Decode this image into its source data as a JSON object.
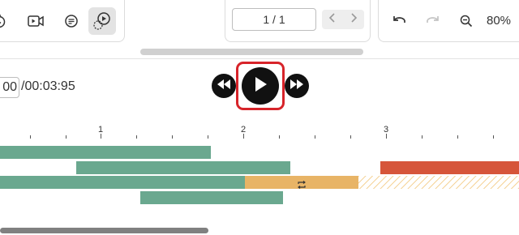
{
  "toolbar": {
    "left_tools": [
      {
        "icon": "timer-icon",
        "active": false
      },
      {
        "icon": "video-icon",
        "active": false
      },
      {
        "icon": "caption-icon",
        "active": false
      },
      {
        "icon": "play-mode-icon",
        "active": true
      }
    ],
    "page_indicator": "1 / 1",
    "zoom": "80%"
  },
  "player": {
    "current_time": "00",
    "total_time": "/00:03:95"
  },
  "timeline": {
    "tick_labels": [
      "1",
      "2",
      "3"
    ],
    "colors": {
      "green": "#6aa88f",
      "orange": "#e8b466",
      "red": "#d6553a",
      "highlight": "#d7242a"
    }
  }
}
